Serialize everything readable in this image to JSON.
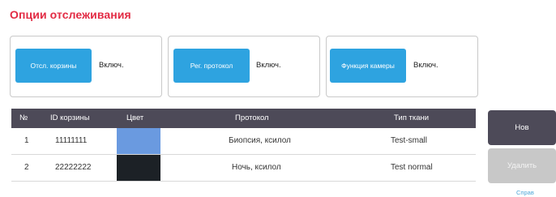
{
  "title": "Опции отслеживания",
  "options": [
    {
      "button_label": "Отсл. корзины",
      "value": "Включ."
    },
    {
      "button_label": "Рег. протокол",
      "value": "Включ."
    },
    {
      "button_label": "Функция камеры",
      "value": "Включ."
    }
  ],
  "table": {
    "headers": {
      "num": "№",
      "basket_id": "ID корзины",
      "color": "Цвет",
      "protocol": "Протокол",
      "tissue_type": "Тип ткани"
    },
    "rows": [
      {
        "num": "1",
        "basket_id": "11111111",
        "color": "#6a9ae0",
        "protocol": "Биопсия, ксилол",
        "tissue_type": "Test-small"
      },
      {
        "num": "2",
        "basket_id": "22222222",
        "color": "#1c2126",
        "protocol": "Ночь, ксилол",
        "tissue_type": "Test normal"
      }
    ]
  },
  "buttons": {
    "new_label": "Нов",
    "delete_label": "Удалить"
  },
  "help_link": "Справ"
}
